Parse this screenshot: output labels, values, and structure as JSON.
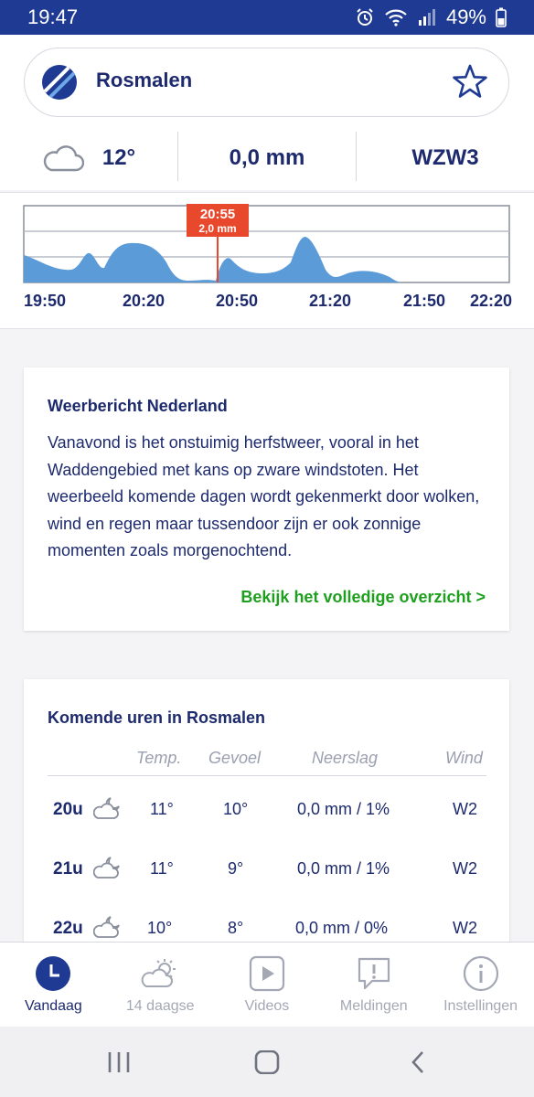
{
  "status": {
    "time": "19:47",
    "battery": "49%"
  },
  "location": {
    "name": "Rosmalen"
  },
  "summary": {
    "temp": "12°",
    "rain": "0,0 mm",
    "wind": "WZW3"
  },
  "radar": {
    "marker_time": "20:55",
    "marker_amount": "2,0 mm",
    "times": [
      "19:50",
      "20:20",
      "20:50",
      "21:20",
      "21:50",
      "22:20"
    ],
    "color": "#5a9bd8",
    "marker_color": "#e8492d"
  },
  "report": {
    "title": "Weerbericht Nederland",
    "text": "Vanavond is het onstuimig herfstweer, vooral in het Waddengebied met kans op zware windstoten. Het weerbeeld komende dagen wordt gekenmerkt door wolken, wind en regen maar tussendoor zijn er ook zonnige momenten zoals morgenochtend.",
    "link": "Bekijk het volledige overzicht >"
  },
  "hourly": {
    "title": "Komende uren in Rosmalen",
    "headers": {
      "temp": "Temp.",
      "feel": "Gevoel",
      "rain": "Neerslag",
      "wind": "Wind"
    },
    "rows": [
      {
        "hour": "20u",
        "temp": "11°",
        "feel": "10°",
        "rain": "0,0 mm / 1%",
        "wind": "W2",
        "icon": "moon-cloud-icon"
      },
      {
        "hour": "21u",
        "temp": "11°",
        "feel": "9°",
        "rain": "0,0 mm / 1%",
        "wind": "W2",
        "icon": "moon-cloud-icon"
      },
      {
        "hour": "22u",
        "temp": "10°",
        "feel": "8°",
        "rain": "0,0 mm / 0%",
        "wind": "W2",
        "icon": "moon-cloud-icon"
      }
    ]
  },
  "nav": [
    {
      "label": "Vandaag",
      "icon": "clock-icon",
      "active": true
    },
    {
      "label": "14 daagse",
      "icon": "sun-cloud-icon",
      "active": false
    },
    {
      "label": "Videos",
      "icon": "play-icon",
      "active": false
    },
    {
      "label": "Meldingen",
      "icon": "alert-bubble-icon",
      "active": false
    },
    {
      "label": "Instellingen",
      "icon": "info-icon",
      "active": false
    }
  ],
  "colors": {
    "primary": "#1d2a6e",
    "statusbar": "#1f3a93",
    "link": "#1ea01e"
  }
}
